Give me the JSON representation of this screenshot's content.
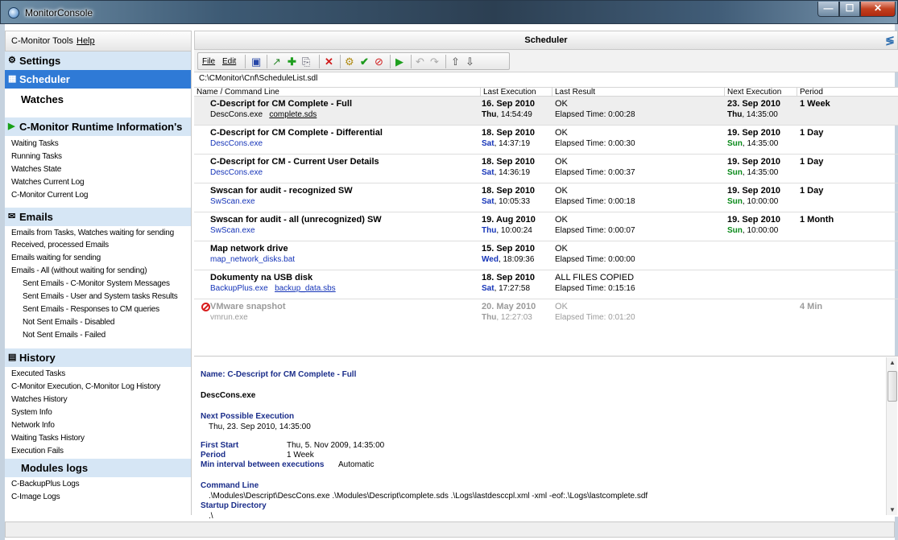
{
  "window": {
    "title": "MonitorConsole",
    "min": "—",
    "max": "☐",
    "close": "✕"
  },
  "menubar": {
    "items": [
      "C-Monitor Tools",
      "Help"
    ]
  },
  "sidebar": {
    "settings": "Settings",
    "scheduler": "Scheduler",
    "watches": "Watches",
    "runtime": {
      "title": "C-Monitor Runtime Information's",
      "items": [
        "Waiting Tasks",
        "Running Tasks",
        "Watches State",
        "Watches Current Log",
        "C-Monitor Current Log"
      ]
    },
    "emails": {
      "title": "Emails",
      "items": [
        "Emails from Tasks, Watches waiting for sending",
        "Received, processed Emails",
        "Emails waiting for sending",
        "Emails - All (without waiting for sending)"
      ],
      "subitems": [
        "Sent Emails - C-Monitor System Messages",
        "Sent Emails - User and System tasks Results",
        "Sent Emails - Responses to CM queries",
        "Not Sent Emails - Disabled",
        "Not Sent Emails - Failed"
      ]
    },
    "history": {
      "title": "History",
      "items": [
        "Executed Tasks",
        "C-Monitor Execution, C-Monitor Log History",
        "Watches History",
        "System Info",
        "Network Info",
        "Waiting Tasks History",
        "Execution Fails"
      ]
    },
    "modules": {
      "title": "Modules logs",
      "items": [
        "C-BackupPlus Logs",
        "C-Image Logs"
      ]
    }
  },
  "main": {
    "title": "Scheduler",
    "toolbar": {
      "file": "File",
      "edit": "Edit"
    },
    "path": "C:\\CMonitor\\Cnf\\ScheduleList.sdl",
    "columns": [
      "Name / Command Line",
      "Last Execution",
      "Last Result",
      "Next Execution",
      "Period"
    ],
    "rows": [
      {
        "name": "C-Descript for CM Complete - Full",
        "exe": "DescCons.exe",
        "arg": "complete.sds",
        "last_date": "16. Sep 2010",
        "last_day": "Thu",
        "last_time": ", 14:54:49",
        "result": "OK",
        "elapsed": "Elapsed Time: 0:00:28",
        "next_date": "23. Sep 2010",
        "next_day": "Thu",
        "next_time": ", 14:35:00",
        "period": "1 Week"
      },
      {
        "name": "C-Descript for CM Complete - Differential",
        "exe": "DescCons.exe",
        "arg": "",
        "last_date": "18. Sep 2010",
        "last_day": "Sat",
        "last_time": ", 14:37:19",
        "result": "OK",
        "elapsed": "Elapsed Time: 0:00:30",
        "next_date": "19. Sep 2010",
        "next_day": "Sun",
        "next_time": ", 14:35:00",
        "period": "1 Day"
      },
      {
        "name": "C-Descript for CM - Current User Details",
        "exe": "DescCons.exe",
        "arg": "",
        "last_date": "18. Sep 2010",
        "last_day": "Sat",
        "last_time": ", 14:36:19",
        "result": "OK",
        "elapsed": "Elapsed Time: 0:00:37",
        "next_date": "19. Sep 2010",
        "next_day": "Sun",
        "next_time": ", 14:35:00",
        "period": "1 Day"
      },
      {
        "name": "Swscan for audit - recognized SW",
        "exe": "SwScan.exe",
        "arg": "",
        "last_date": "18. Sep 2010",
        "last_day": "Sat",
        "last_time": ", 10:05:33",
        "result": "OK",
        "elapsed": "Elapsed Time: 0:00:18",
        "next_date": "19. Sep 2010",
        "next_day": "Sun",
        "next_time": ", 10:00:00",
        "period": "1 Day"
      },
      {
        "name": "Swscan for audit - all (unrecognized) SW",
        "exe": "SwScan.exe",
        "arg": "",
        "last_date": "19. Aug 2010",
        "last_day": "Thu",
        "last_time": ", 10:00:24",
        "result": "OK",
        "elapsed": "Elapsed Time: 0:00:07",
        "next_date": "19. Sep 2010",
        "next_day": "Sun",
        "next_time": ", 10:00:00",
        "period": "1 Month"
      },
      {
        "name": "Map network drive",
        "exe": "map_network_disks.bat",
        "arg": "",
        "last_date": "15. Sep 2010",
        "last_day": "Wed",
        "last_time": ", 18:09:36",
        "result": "OK",
        "elapsed": "Elapsed Time: 0:00:00",
        "next_date": "",
        "next_day": "",
        "next_time": "",
        "period": ""
      },
      {
        "name": "Dokumenty na USB disk",
        "exe": "BackupPlus.exe",
        "arg": "backup_data.sbs",
        "last_date": "18. Sep 2010",
        "last_day": "Sat",
        "last_time": ", 17:27:58",
        "result": "ALL FILES COPIED",
        "elapsed": "Elapsed Time: 0:15:16",
        "next_date": "",
        "next_day": "",
        "next_time": "",
        "period": ""
      },
      {
        "name": "VMware snapshot",
        "exe": "vmrun.exe",
        "arg": "",
        "last_date": "20. May 2010",
        "last_day": "Thu",
        "last_time": ", 12:27:03",
        "result": "OK",
        "elapsed": "Elapsed Time: 0:01:20",
        "next_date": "",
        "next_day": "",
        "next_time": "",
        "period": "4 Min"
      }
    ]
  },
  "details": {
    "name_label": "Name:",
    "name_value": "C-Descript for CM Complete - Full",
    "exe": "DescCons.exe",
    "next_label": "Next Possible Execution",
    "next_value": "Thu, 23. Sep 2010, 14:35:00",
    "first_label": "First Start",
    "first_value": "Thu, 5. Nov 2009, 14:35:00",
    "period_label": "Period",
    "period_value": "1 Week",
    "interval_label": "Min interval between executions",
    "interval_value": "Automatic",
    "cmd_label": "Command Line",
    "cmd_value": ".\\Modules\\Descript\\DescCons.exe .\\Modules\\Descript\\complete.sds .\\Logs\\lastdesccpl.xml -xml -eof:.\\Logs\\lastcomplete.sdf",
    "dir_label": "Startup Directory",
    "dir_value": ".\\"
  }
}
